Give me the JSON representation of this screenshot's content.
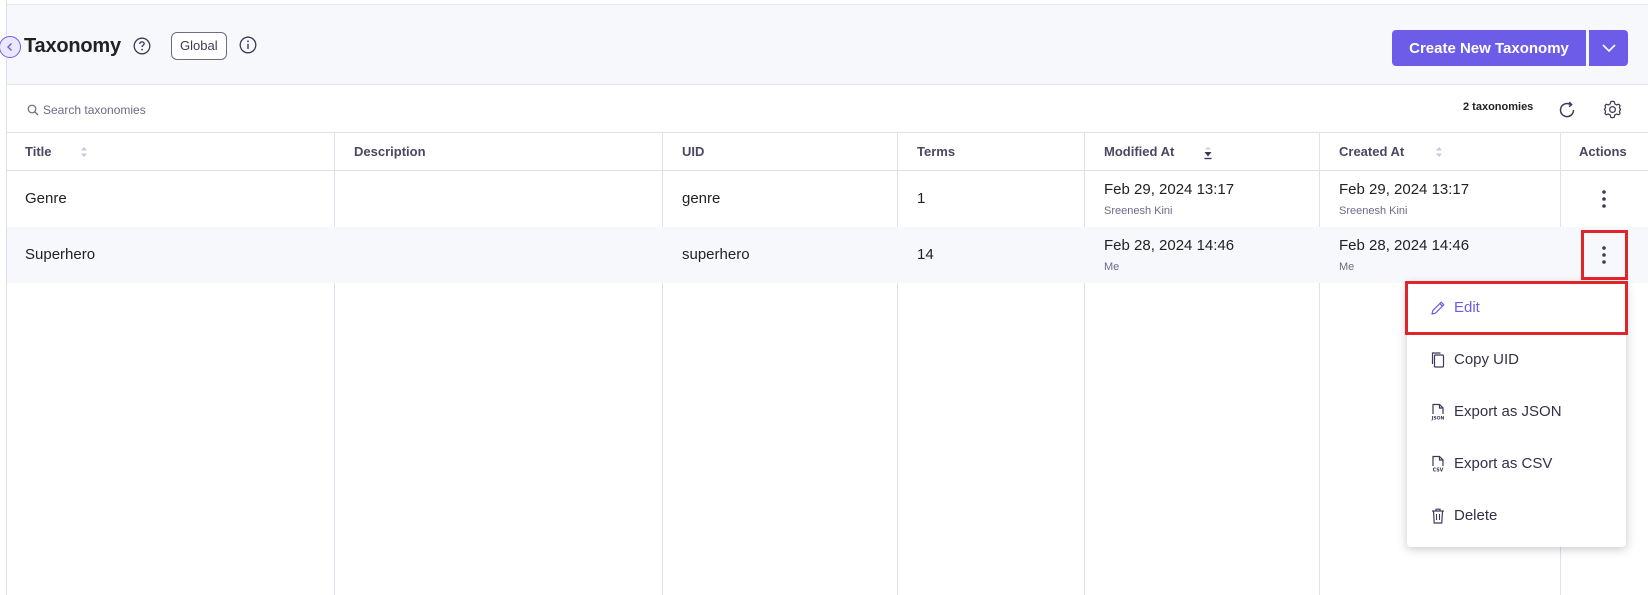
{
  "header": {
    "title": "Taxonomy",
    "badge": "Global",
    "create_button": "Create New Taxonomy"
  },
  "toolbar": {
    "search_placeholder": "Search taxonomies",
    "count": "2 taxonomies"
  },
  "table": {
    "columns": [
      "Title",
      "Description",
      "UID",
      "Terms",
      "Modified At",
      "Created At",
      "Actions"
    ],
    "sorted_column": "Modified At",
    "rows": [
      {
        "title": "Genre",
        "description": "",
        "uid": "genre",
        "terms": "1",
        "modified_at": "Feb 29, 2024 13:17",
        "modified_by": "Sreenesh Kini",
        "created_at": "Feb 29, 2024 13:17",
        "created_by": "Sreenesh Kini"
      },
      {
        "title": "Superhero",
        "description": "",
        "uid": "superhero",
        "terms": "14",
        "modified_at": "Feb 28, 2024 14:46",
        "modified_by": "Me",
        "created_at": "Feb 28, 2024 14:46",
        "created_by": "Me"
      }
    ]
  },
  "actions_menu": {
    "items": [
      {
        "label": "Edit",
        "icon": "pencil-icon",
        "active": true
      },
      {
        "label": "Copy UID",
        "icon": "copy-icon"
      },
      {
        "label": "Export as JSON",
        "icon": "json-file-icon"
      },
      {
        "label": "Export as CSV",
        "icon": "csv-file-icon"
      },
      {
        "label": "Delete",
        "icon": "trash-icon"
      }
    ]
  },
  "colors": {
    "accent": "#6c5ce7",
    "highlight": "#e1242a",
    "header_bg": "#f7f8fc",
    "border": "#dfe1ea"
  }
}
